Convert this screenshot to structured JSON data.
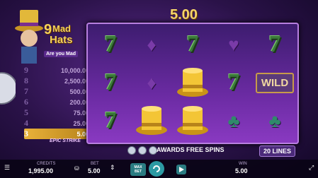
{
  "game": {
    "logo_number": "9",
    "logo_line1": "Mad",
    "logo_line2": "Hats",
    "logo_tagline": "Are you Mad",
    "win_total": "5.00"
  },
  "paytable": [
    {
      "count": "9",
      "value": "10,000.00",
      "active": false
    },
    {
      "count": "8",
      "value": "2,500.00",
      "active": false
    },
    {
      "count": "7",
      "value": "500.00",
      "active": false
    },
    {
      "count": "6",
      "value": "200.00",
      "active": false
    },
    {
      "count": "5",
      "value": "75.00",
      "active": false
    },
    {
      "count": "4",
      "value": "25.00",
      "active": false
    },
    {
      "count": "3",
      "value": "5.00",
      "active": true
    }
  ],
  "epic_strike": "EPIC STRIKE",
  "reels": [
    [
      "seven",
      "seven",
      "seven"
    ],
    [
      "diamond",
      "diamond",
      "hat"
    ],
    [
      "seven",
      "hat",
      "hat"
    ],
    [
      "heart",
      "seven",
      "club"
    ],
    [
      "seven",
      "wild",
      "club"
    ]
  ],
  "wild_label": "WILD",
  "awards_text": "AWARDS FREE SPINS",
  "lines_label": "20 LINES",
  "bottom_bar": {
    "credits_label": "CREDITS",
    "credits_value": "1,995.00",
    "bet_label": "BET",
    "bet_value": "5.00",
    "max_bet_line1": "MAX",
    "max_bet_line2": "BET",
    "win_label": "WIN",
    "win_value": "5.00"
  },
  "colors": {
    "accent": "#f6d56a",
    "background": "#2a1248",
    "reel_frame": "#6b2ba3",
    "button": "#2c9aa3"
  }
}
